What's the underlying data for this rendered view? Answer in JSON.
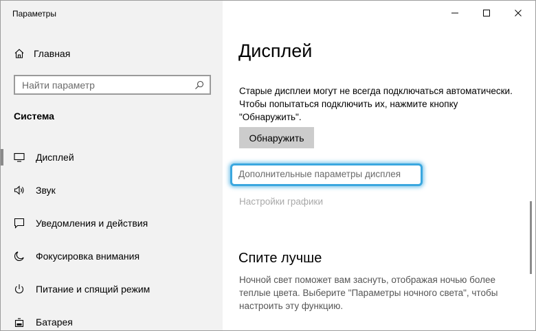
{
  "window": {
    "title": "Параметры"
  },
  "sidebar": {
    "home_label": "Главная",
    "search_placeholder": "Найти параметр",
    "section_title": "Система",
    "items": [
      {
        "label": "Дисплей",
        "icon": "monitor-icon",
        "active": true
      },
      {
        "label": "Звук",
        "icon": "speaker-icon",
        "active": false
      },
      {
        "label": "Уведомления и действия",
        "icon": "notification-icon",
        "active": false
      },
      {
        "label": "Фокусировка внимания",
        "icon": "moon-icon",
        "active": false
      },
      {
        "label": "Питание и спящий режим",
        "icon": "power-icon",
        "active": false
      },
      {
        "label": "Батарея",
        "icon": "battery-icon",
        "active": false
      }
    ]
  },
  "main": {
    "title": "Дисплей",
    "description": "Старые дисплеи могут не всегда подключаться автоматически. Чтобы попытаться подключить их, нажмите кнопку \"Обнаружить\".",
    "detect_button": "Обнаружить",
    "advanced_link": "Дополнительные параметры дисплея",
    "graphics_link": "Настройки графики",
    "sleep_title": "Спите лучше",
    "sleep_description": "Ночной свет поможет вам заснуть, отображая ночью более теплые цвета. Выберите \"Параметры ночного света\", чтобы настроить эту функцию."
  },
  "colors": {
    "highlight": "#3aa7df",
    "sidebar_bg": "#f2f2f2"
  }
}
